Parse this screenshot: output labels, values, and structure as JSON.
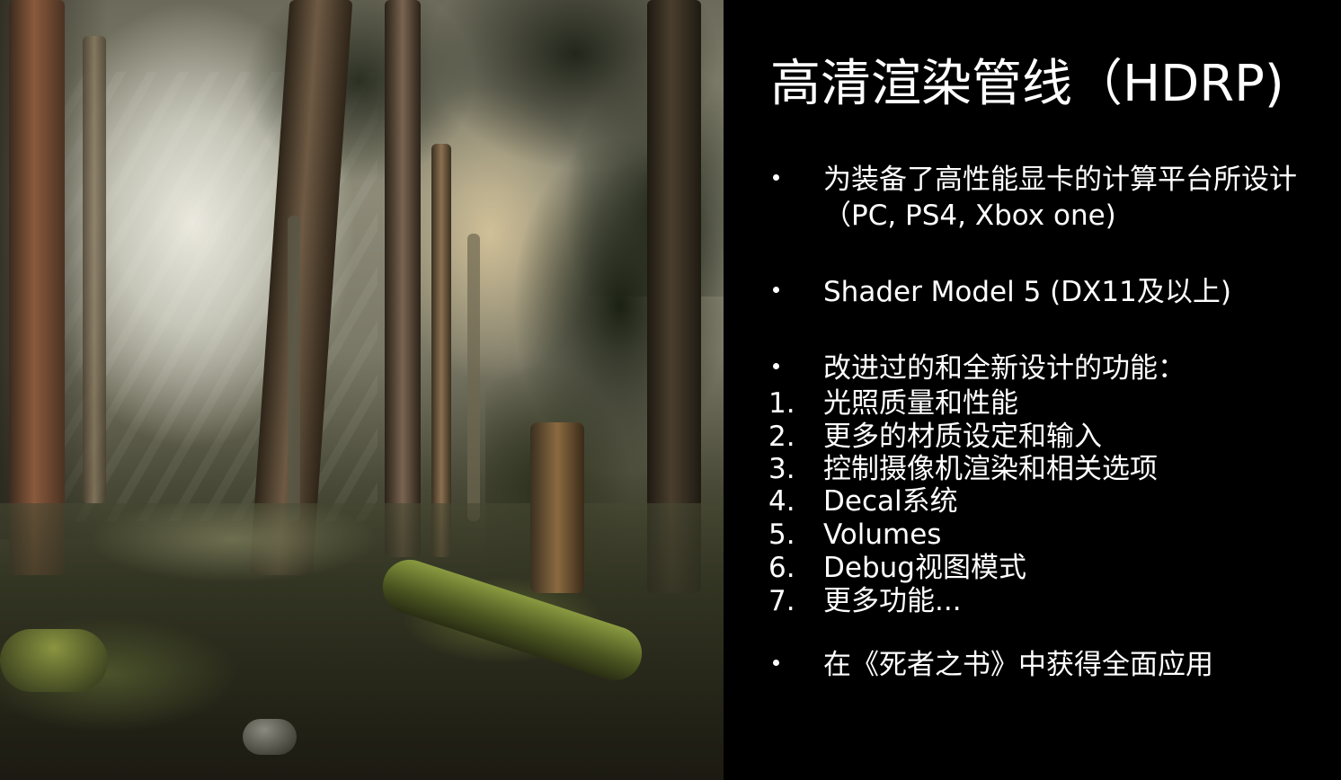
{
  "slide": {
    "title": "高清渲染管线（HDRP)",
    "bullets": [
      "为装备了高性能显卡的计算平台所设计（PC, PS4, Xbox one)",
      "Shader Model 5 (DX11及以上)",
      "改进过的和全新设计的功能："
    ],
    "features": [
      {
        "num": "1.",
        "text": "光照质量和性能"
      },
      {
        "num": "2.",
        "text": "更多的材质设定和输入"
      },
      {
        "num": "3.",
        "text": "控制摄像机渲染和相关选项"
      },
      {
        "num": "4.",
        "text": "Decal系统"
      },
      {
        "num": "5.",
        "text": "Volumes"
      },
      {
        "num": "6.",
        "text": "Debug视图模式"
      },
      {
        "num": "7.",
        "text": "更多功能..."
      }
    ],
    "last_bullet": "在《死者之书》中获得全面应用"
  },
  "colors": {
    "background": "#000000",
    "text": "#ffffff"
  }
}
